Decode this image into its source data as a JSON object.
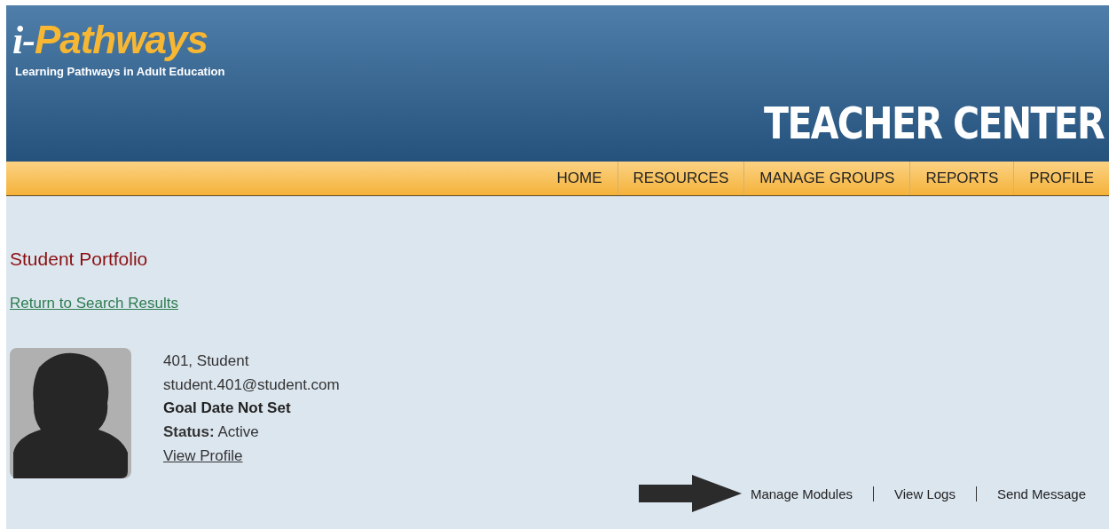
{
  "header": {
    "logo": {
      "prefix": "i-",
      "name": "Pathways"
    },
    "tagline": "Learning Pathways in Adult Education",
    "banner": "TEACHER CENTER"
  },
  "nav": [
    {
      "label": "HOME"
    },
    {
      "label": "RESOURCES"
    },
    {
      "label": "MANAGE GROUPS"
    },
    {
      "label": "REPORTS"
    },
    {
      "label": "PROFILE"
    }
  ],
  "page_title": "Student Portfolio",
  "back_link": "Return to Search Results",
  "student": {
    "name": "401, Student",
    "email": "student.401@student.com",
    "goal": "Goal Date Not Set",
    "status": "**Status:** Active",
    "profile_link": "View Profile"
  },
  "actions": [
    "Manage Modules",
    "View Logs",
    "Send Message"
  ]
}
